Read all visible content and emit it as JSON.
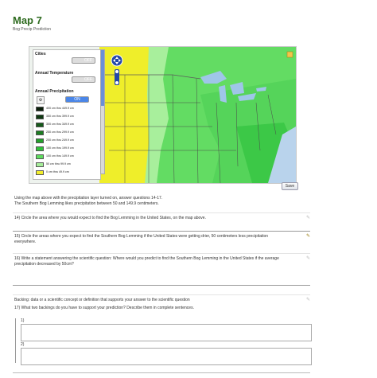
{
  "header": {
    "title": "Map 7",
    "subtitle": "Bog Precip Prediction"
  },
  "legend": {
    "cities_label": "Cities",
    "cities_toggle": "OFF",
    "temp_label": "Annual Temperature",
    "temp_toggle": "OFF",
    "precip_label": "Annual Precipitation",
    "precip_toggle": "ON",
    "items": [
      {
        "label": "400 cm thru 449.9 cm",
        "color": "#0a1e0a"
      },
      {
        "label": "350 cm thru 399.9 cm",
        "color": "#0f3a12"
      },
      {
        "label": "300 cm thru 349.9 cm",
        "color": "#155a1a"
      },
      {
        "label": "250 cm thru 299.9 cm",
        "color": "#1c7d22"
      },
      {
        "label": "200 cm thru 249.9 cm",
        "color": "#23a12b"
      },
      {
        "label": "150 cm thru 199.9 cm",
        "color": "#2fc23a"
      },
      {
        "label": "100 cm thru 149.9 cm",
        "color": "#5edc5e"
      },
      {
        "label": "50 cm thru 99.9 cm",
        "color": "#a6ee9a"
      },
      {
        "label": "0 cm thru 49.9 cm",
        "color": "#f2ee2a"
      }
    ]
  },
  "map": {
    "save_label": "Save"
  },
  "instructions": {
    "line1": "Using the map above with the precipitation layer turned on, answer questions 14-17.",
    "line2": "The Southern Bog Lemming likes precipitation between 50 and 149.9 centimeters."
  },
  "questions": {
    "q14": "14) Circle the area where you would expect to find the Bog Lemming in the United States, on the map above.",
    "q15a": "15) Circle the areas where you expect to find the Southern Bog Lemming if the United States were getting drier, 50 centimeters less precipitation",
    "q15b": "everywhere.",
    "q16a": "16) Write a statement answering the scientific question: Where would you predict to find the Southern Bog Lemming in the United States if the average",
    "q16b": "precipitation decreased by 50cm?",
    "backing": "Backing: data or a scientific concept or definition that supports your answer to the scientific question",
    "q17": "17) What two backings do you have to support your prediction? Describe them in complete sentences.",
    "ans1": "1)",
    "ans2": "2)"
  }
}
